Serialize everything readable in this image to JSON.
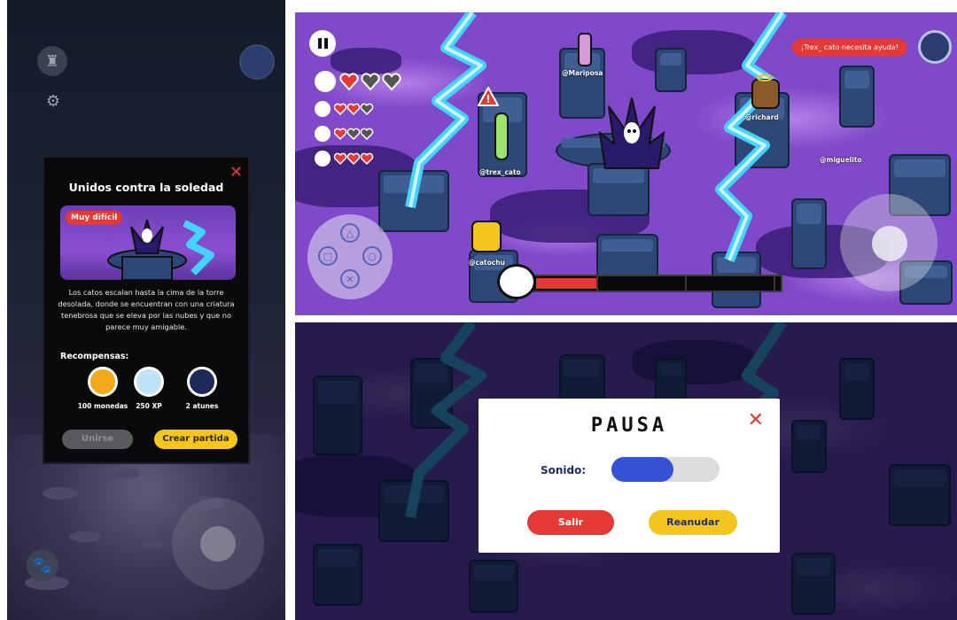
{
  "mission": {
    "title": "Unidos contra la soledad",
    "difficulty": "Muy difícil",
    "description": "Los catos escalan hasta la cima de la torre desolada, donde se encuentran con una criatura tenebrosa que se eleva por las nubes y que no parece muy amigable.",
    "rewards_title": "Recompensas:",
    "rewards": [
      {
        "label": "100 monedas",
        "icon": "coin-icon"
      },
      {
        "label": "250 XP",
        "icon": "xp-icon"
      },
      {
        "label": "2 atunes",
        "icon": "tuna-can-icon"
      }
    ],
    "join_label": "Unirse",
    "create_label": "Crear partida"
  },
  "game": {
    "players": [
      {
        "name": "@Mariposa"
      },
      {
        "name": "@richard"
      },
      {
        "name": "@trex_cato"
      },
      {
        "name": "@miguelito"
      },
      {
        "name": "@catochu"
      }
    ],
    "lives": [
      {
        "filled": 1,
        "empty": 2
      },
      {
        "filled": 2,
        "empty": 1
      },
      {
        "filled": 1,
        "empty": 2
      },
      {
        "filled": 3,
        "empty": 0
      }
    ],
    "help_message": "¡Trex_ cato necesita ayuda!",
    "boss_health_fraction": 0.25,
    "colors": {
      "accent_red": "#e53935",
      "accent_yellow": "#f4c51c",
      "slider_blue": "#3552d6"
    }
  },
  "pause": {
    "title": "PAUSA",
    "sound_label": "Sonido:",
    "sound_level": 0.57,
    "exit_label": "Salir",
    "resume_label": "Reanudar"
  }
}
